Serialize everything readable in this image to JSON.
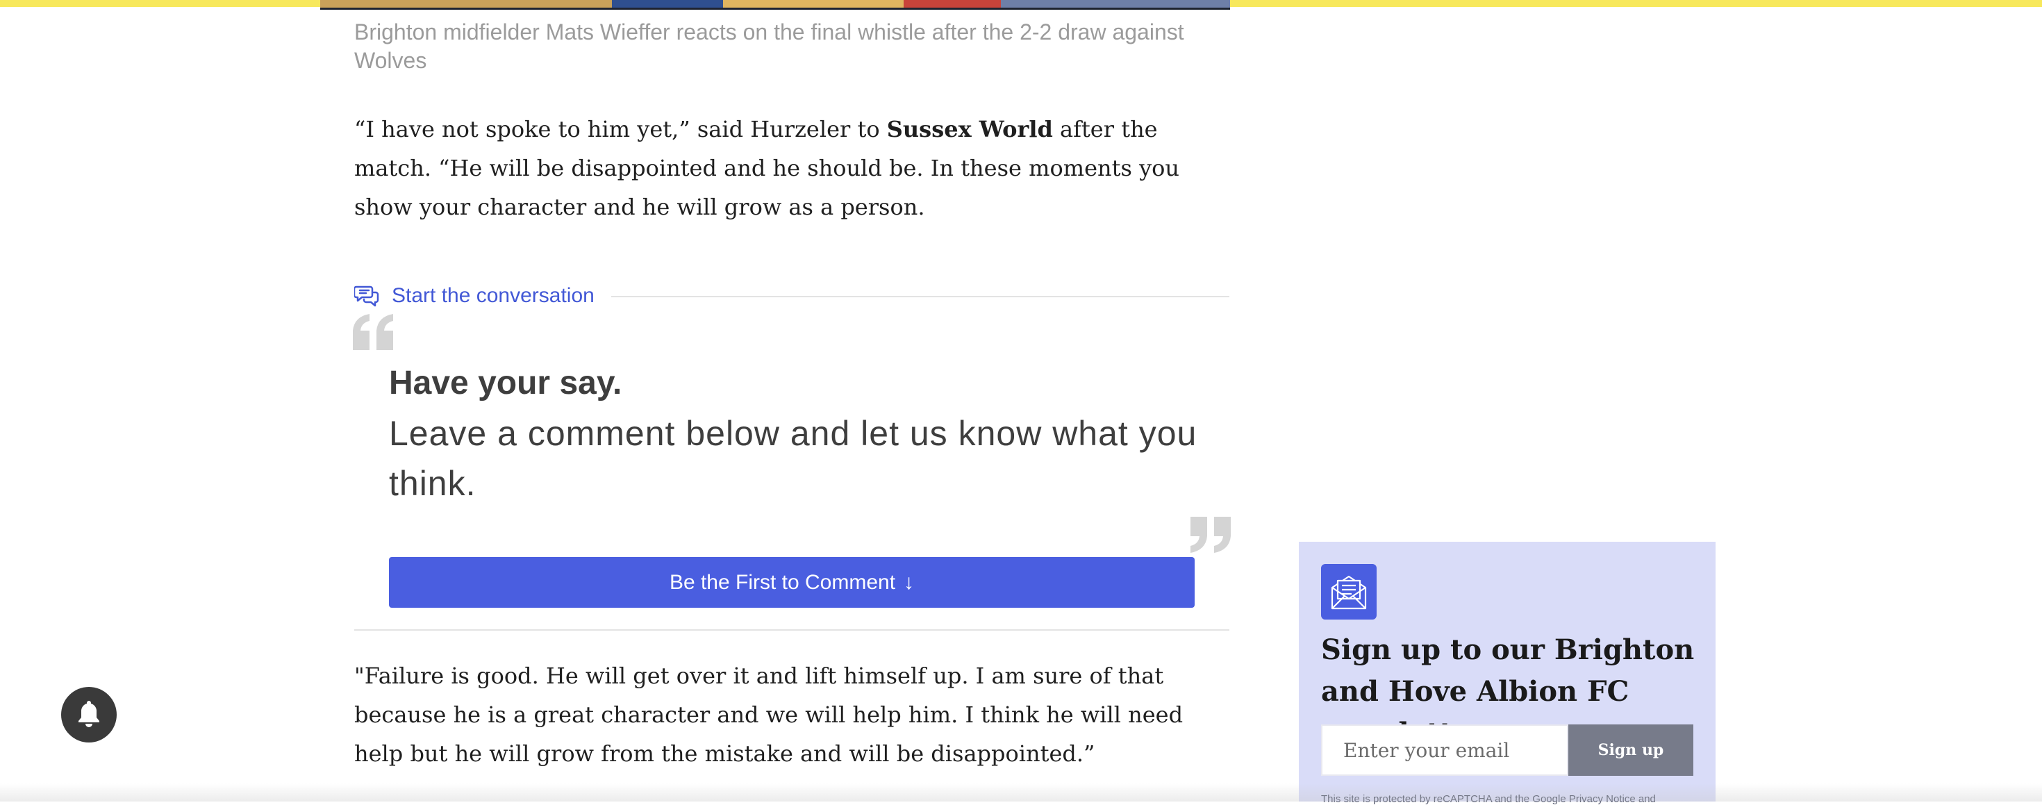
{
  "article": {
    "caption": "Brighton midfielder Mats Wieffer reacts on the final whistle after the 2-2 draw against Wolves",
    "paragraph1": {
      "before": "“I have not spoke to him yet,” said Hurzeler to ",
      "bold": "Sussex World",
      "after": " after the match. “He will be disappointed and he should be. In these moments you show your character and he will grow as a person."
    },
    "paragraph2": "\"Failure is good. He will get over it and lift himself up. I am sure of that because he is a great character and we will help him. I think he will need help but he will grow from the mistake and will be disappointed.”"
  },
  "conversation": {
    "link_label": "Start the conversation",
    "icon": "chat-bubbles-icon"
  },
  "have_your_say": {
    "title": "Have your say.",
    "subtitle": "Leave a comment below and let us know what you think.",
    "button_label": "Be the First to Comment",
    "button_arrow": "↓"
  },
  "newsletter": {
    "icon": "envelope-icon",
    "title": "Sign up to our Brighton and Hove Albion FC newsletter",
    "email_placeholder": "Enter your email",
    "email_value": "",
    "signup_label": "Sign up",
    "legal": "This site is protected by reCAPTCHA and the Google Privacy Notice and"
  },
  "notification": {
    "icon": "bell-icon"
  },
  "colors": {
    "accent": "#4a5ee0",
    "link": "#4258d6",
    "top_bar": "#f7e85c",
    "newsletter_bg": "#d9dcf8"
  }
}
